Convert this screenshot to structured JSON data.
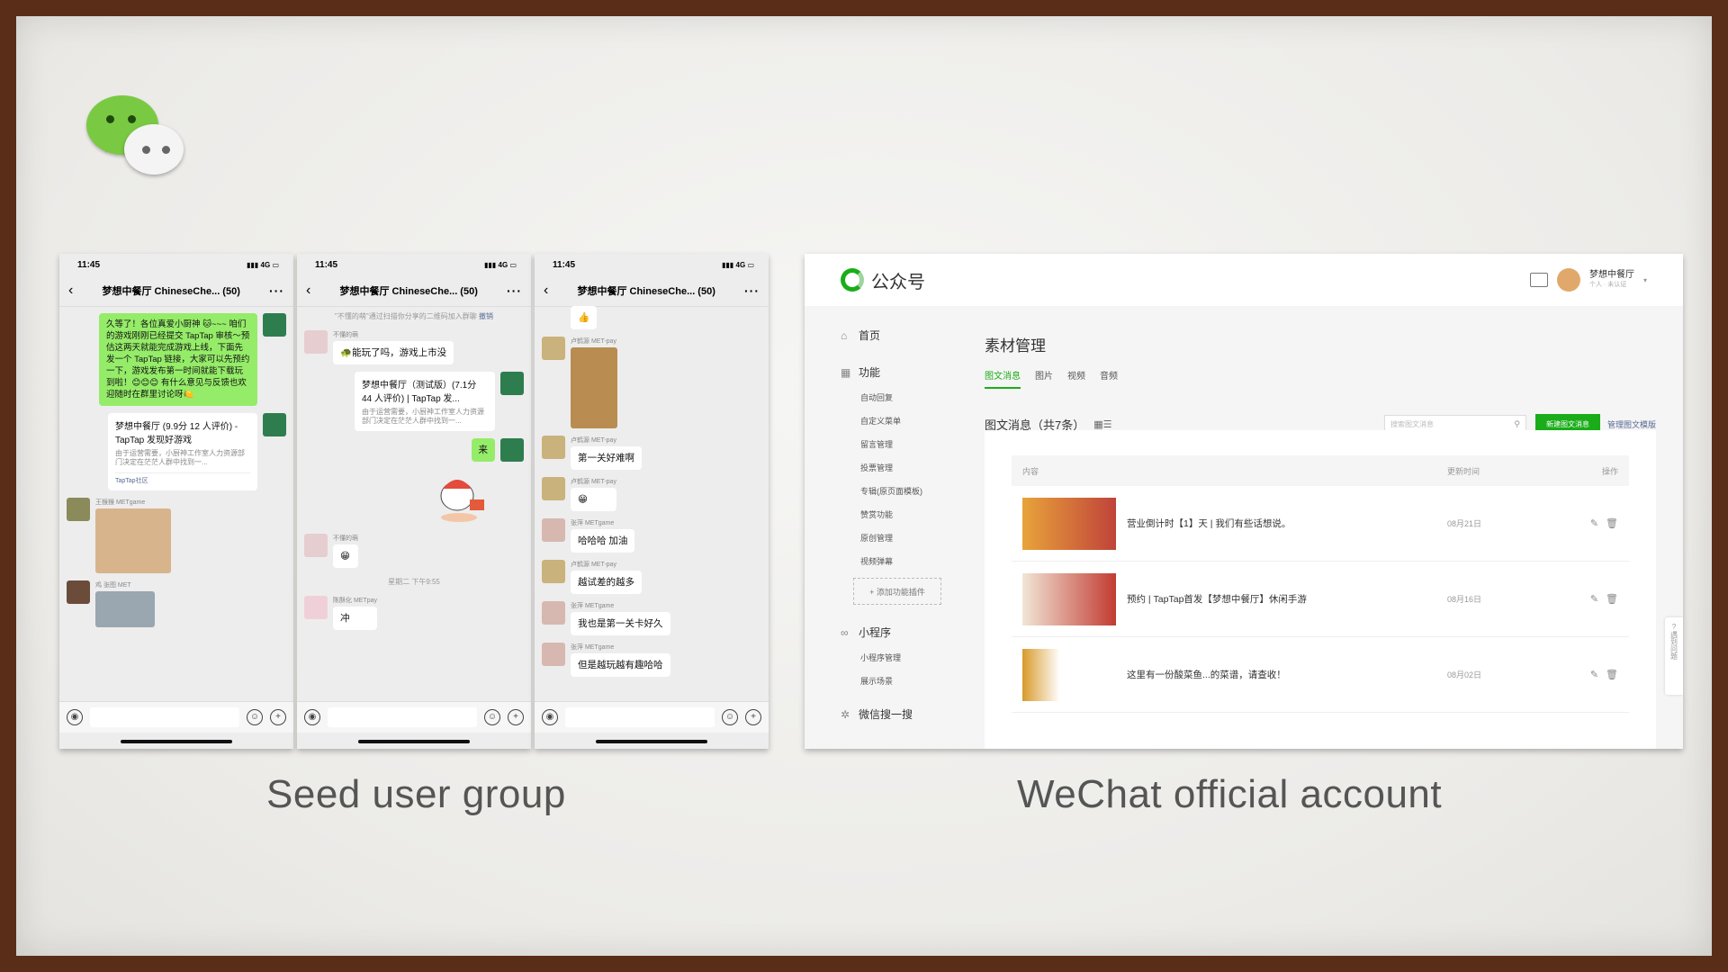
{
  "captions": {
    "left": "Seed user group",
    "right": "WeChat official account"
  },
  "phones": [
    {
      "time": "11:45",
      "network": "4G",
      "chat_title": "梦想中餐厅 ChineseChe... (50)",
      "messages": {
        "m1": "久等了！各位真爱小厨神 🐱~~~ 咱们的游戏刚刚已经提交 TapTap 审核～预估这两天就能完成游戏上线，下面先发一个 TapTap 链接，大家可以先预约一下，游戏发布第一时间就能下载玩到啦！😊😊😊 有什么意见与反馈也欢迎随时在群里讨论呀🍋",
        "card_title": "梦想中餐厅 (9.9分 12 人评价) - TapTap 发现好游戏",
        "card_sub": "由于运营需要，小厨神工作室人力资源部门决定在茫茫人群中找到一...",
        "card_src": "TapTap社区",
        "nick1": "王猴猴 METgame",
        "nick2": "鸡 张图 MET"
      }
    },
    {
      "time": "11:45",
      "network": "4G",
      "chat_title": "梦想中餐厅 ChineseChe... (50)",
      "messages": {
        "sys1": "\"不懂的萌\"通过扫描你分享的二维码加入群聊",
        "sys1_link": "撤销",
        "nick1": "不懂的萌",
        "m1": "🐢能玩了吗，游戏上市没",
        "card_title": "梦想中餐厅（测试版）(7.1分 44 人评价) | TapTap 发...",
        "card_sub": "由于运营需要，小厨神工作室人力资源部门决定在茫茫人群中找到一...",
        "m2": "来",
        "nick2": "不懂的萌",
        "m3": "😁",
        "time_sep": "星期二 下午9:55",
        "nick3": "陈酥化 METpay",
        "m4": "冲"
      }
    },
    {
      "time": "11:45",
      "network": "4G",
      "chat_title": "梦想中餐厅 ChineseChe... (50)",
      "messages": {
        "m0": "👍",
        "nick1": "卢鹤源 MET-pay",
        "nick2": "卢鹤源 MET-pay",
        "m1": "第一关好难啊",
        "nick3": "卢鹤源 MET-pay",
        "m2": "😁",
        "nick4": "张萍 METgame",
        "m3": "哈哈哈 加油",
        "nick5": "卢鹤源 MET-pay",
        "m4": "越试差的越多",
        "nick6": "张萍 METgame",
        "m5": "我也是第一关卡好久",
        "nick7": "张萍 METgame",
        "m6": "但是越玩越有趣哈哈"
      }
    }
  ],
  "oa": {
    "brand": "公众号",
    "user_name": "梦想中餐厅",
    "user_sub": "个人 · 未认证",
    "nav": {
      "home": "首页",
      "func": "功能",
      "func_items": [
        "自动回复",
        "自定义菜单",
        "留言管理",
        "投票管理",
        "专辑(原页面模板)",
        "赞赏功能",
        "原创管理",
        "视频弹幕"
      ],
      "add_plugin": "+ 添加功能插件",
      "mini": "小程序",
      "mini_items": [
        "小程序管理",
        "展示场景"
      ],
      "search": "微信搜一搜"
    },
    "page_title": "素材管理",
    "tabs": [
      "图文消息",
      "图片",
      "视频",
      "音频"
    ],
    "list_label": "图文消息（共7条）",
    "search_placeholder": "搜索图文消息",
    "new_button": "新建图文消息",
    "template_link": "管理图文模版",
    "columns": {
      "content": "内容",
      "time": "更新时间",
      "ops": "操作"
    },
    "items": [
      {
        "title": "营业倒计时【1】天 | 我们有些话想说。",
        "date": "08月21日"
      },
      {
        "title": "预约 | TapTap首发【梦想中餐厅】休闲手游",
        "date": "08月16日"
      },
      {
        "title": "这里有一份酸菜鱼...的菜谱，请查收！",
        "date": "08月02日"
      }
    ],
    "help": "遇到问题"
  },
  "colors": {
    "wechat_green": "#1aad19",
    "bubble_green": "#95ec69",
    "frame_brown": "#5a2d18"
  }
}
